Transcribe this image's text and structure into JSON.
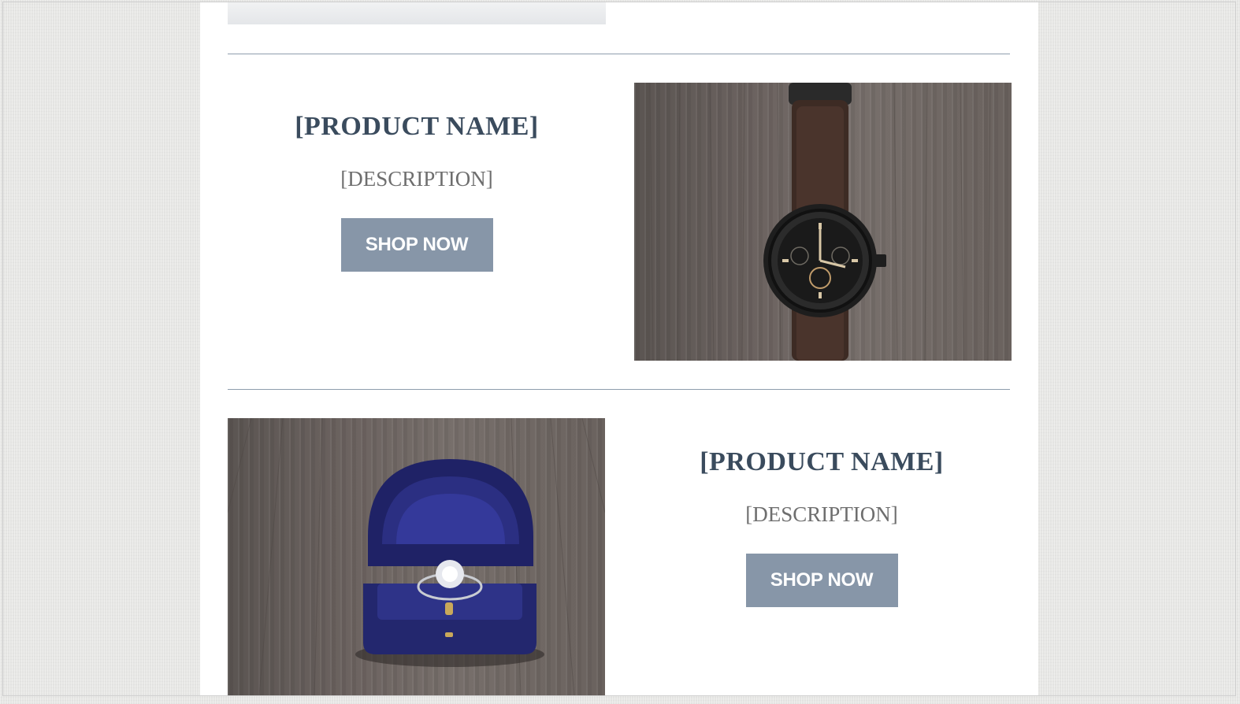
{
  "products": [
    {
      "name": "[PRODUCT NAME]",
      "description": "[DESCRIPTION]",
      "button_label": "SHOP NOW",
      "image": "watch-on-wood"
    },
    {
      "name": "[PRODUCT NAME]",
      "description": "[DESCRIPTION]",
      "button_label": "SHOP NOW",
      "image": "ring-in-box-on-wood"
    }
  ],
  "colors": {
    "heading": "#3a4b5d",
    "description": "#6e6e6e",
    "button_bg": "#8796a8",
    "button_text": "#ffffff",
    "divider": "#8e9dad",
    "page_bg": "#e6e6e4",
    "email_bg": "#ffffff"
  }
}
